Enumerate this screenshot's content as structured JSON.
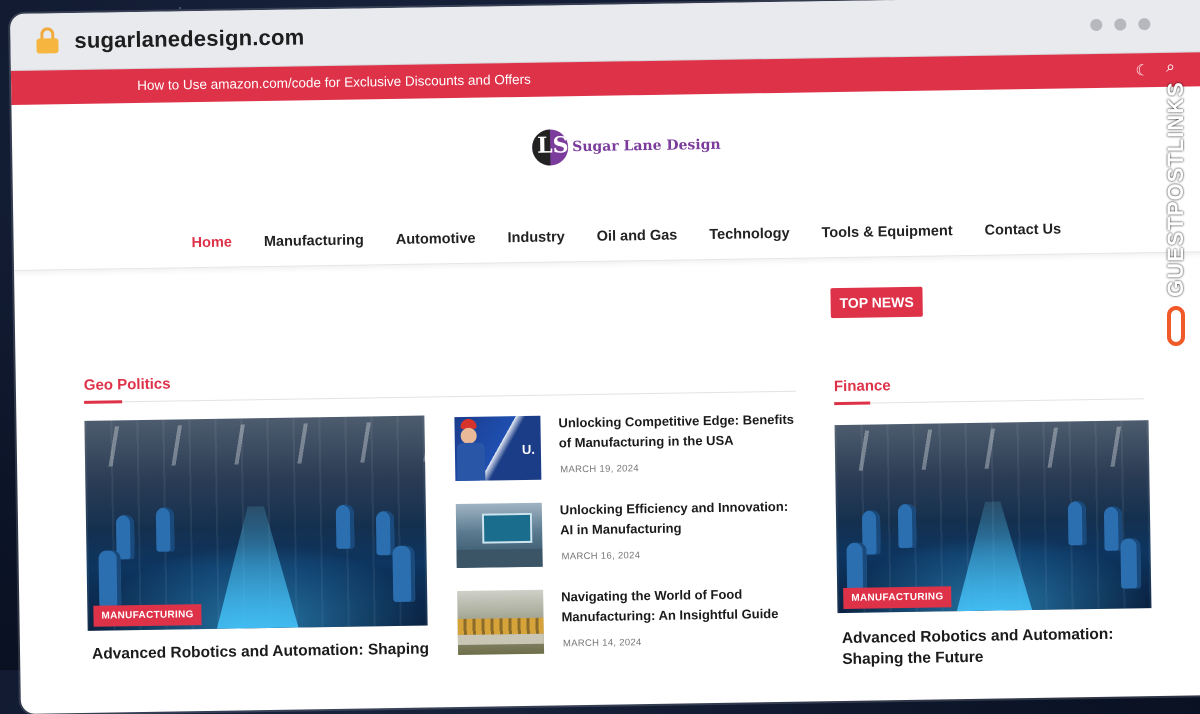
{
  "browser": {
    "url": "sugarlanedesign.com"
  },
  "topbar": {
    "ticker": "How to Use amazon.com/code for Exclusive Discounts and Offers"
  },
  "logo": {
    "text": "Sugar Lane Design",
    "mark": "LS"
  },
  "nav": {
    "items": [
      "Home",
      "Manufacturing",
      "Automotive",
      "Industry",
      "Oil and Gas",
      "Technology",
      "Tools & Equipment",
      "Contact Us"
    ],
    "active": "Home"
  },
  "top_news": {
    "label": "TOP NEWS"
  },
  "geo_politics": {
    "heading": "Geo Politics",
    "featured": {
      "category": "MANUFACTURING",
      "title": "Advanced Robotics and Automation: Shaping"
    },
    "list": [
      {
        "title": "Unlocking Competitive Edge: Benefits of Manufacturing in the USA",
        "date": "MARCH 19, 2024",
        "thumb_label": "U."
      },
      {
        "title": "Unlocking Efficiency and Innovation: AI in Manufacturing",
        "date": "MARCH 16, 2024"
      },
      {
        "title": "Navigating the World of Food Manufacturing: An Insightful Guide",
        "date": "MARCH 14, 2024"
      }
    ]
  },
  "finance": {
    "heading": "Finance",
    "featured": {
      "category": "MANUFACTURING",
      "title": "Advanced Robotics and Automation: Shaping the Future"
    }
  },
  "watermark": {
    "text": "GUESTPOSTLINKS"
  },
  "colors": {
    "accent": "#de3249",
    "logo_purple": "#7b3c9c"
  },
  "icons": {
    "lock": "lock-icon",
    "moon": "moon-icon",
    "search": "search-icon",
    "link": "link-icon"
  }
}
